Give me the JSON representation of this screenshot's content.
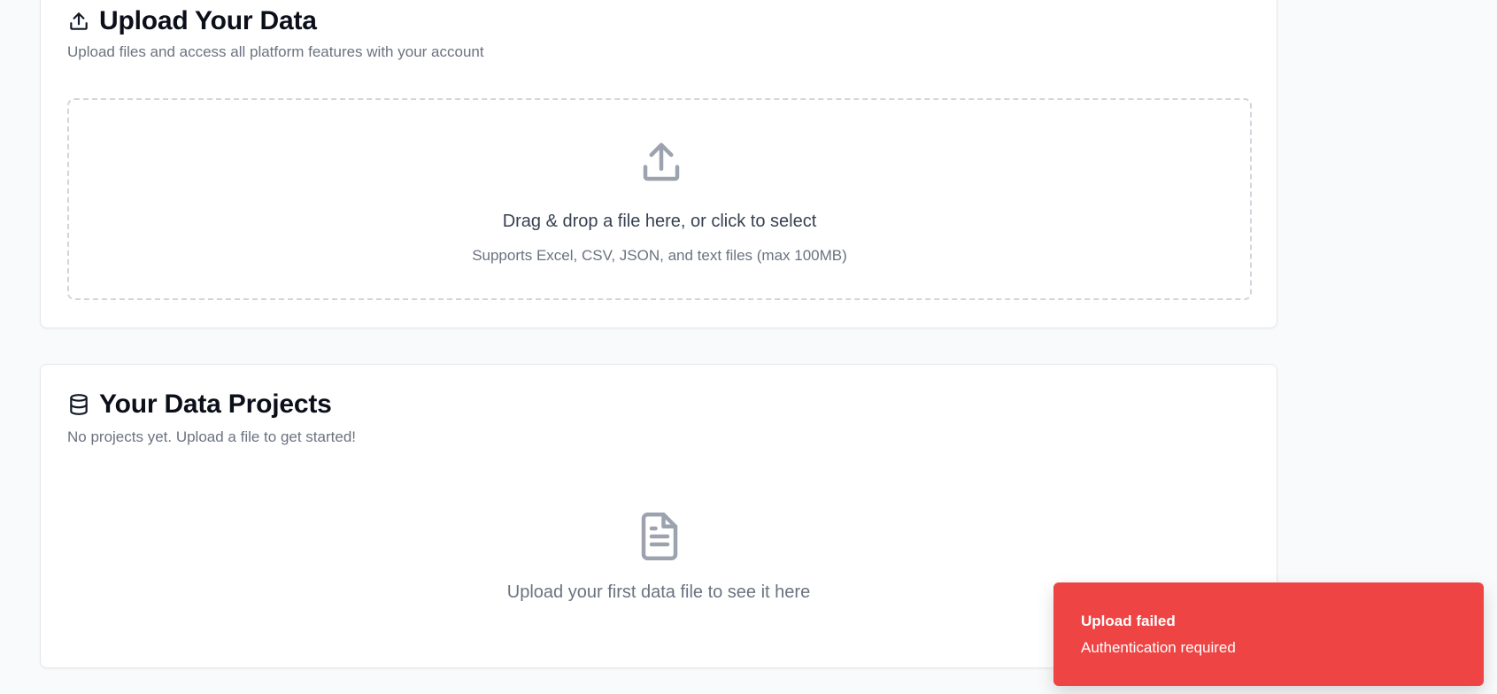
{
  "upload_section": {
    "title": "Upload Your Data",
    "subtitle": "Upload files and access all platform features with your account",
    "title_icon": "upload-icon",
    "dropzone": {
      "icon": "upload-icon",
      "primary_text": "Drag & drop a file here, or click to select",
      "secondary_text": "Supports Excel, CSV, JSON, and text files (max 100MB)"
    }
  },
  "projects_section": {
    "title": "Your Data Projects",
    "subtitle": "No projects yet. Upload a file to get started!",
    "title_icon": "database-icon",
    "empty_state": {
      "icon": "file-text-icon",
      "text": "Upload your first data file to see it here"
    }
  },
  "toast": {
    "title": "Upload failed",
    "description": "Authentication required",
    "color": "#ef4444"
  },
  "colors": {
    "background": "#f9fafb",
    "card": "#ffffff",
    "border": "#e5e7eb",
    "muted_text": "#6b7280",
    "icon_gray": "#9ca3af",
    "error": "#ef4444"
  }
}
